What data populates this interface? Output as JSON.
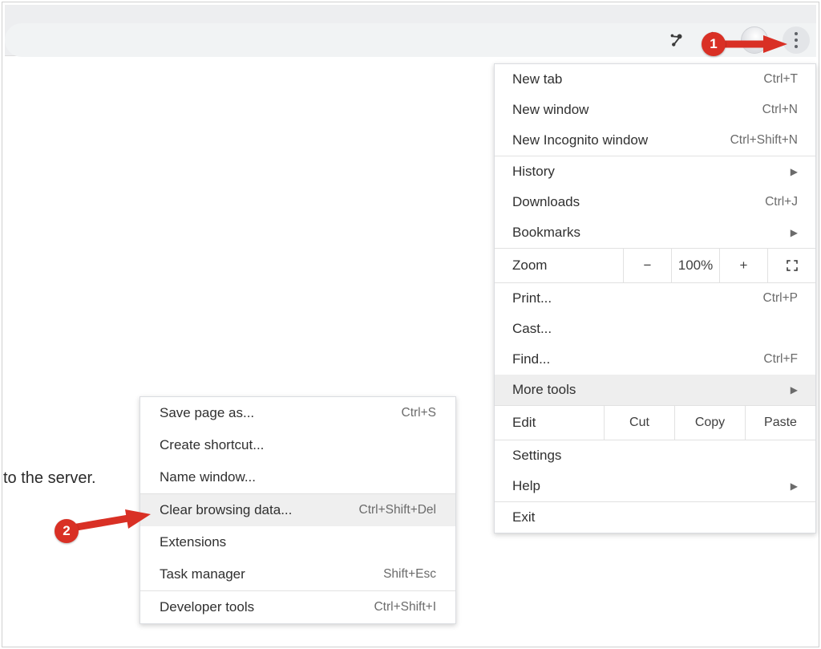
{
  "page": {
    "fragment_text": "to the server."
  },
  "toolbar": {
    "icons": {
      "hubspot": "hubspot-icon",
      "extensions": "extensions-icon",
      "profile": "profile-icon",
      "more": "more-vert-icon"
    }
  },
  "menu": {
    "sections": [
      {
        "items": [
          {
            "label": "New tab",
            "shortcut": "Ctrl+T"
          },
          {
            "label": "New window",
            "shortcut": "Ctrl+N"
          },
          {
            "label": "New Incognito window",
            "shortcut": "Ctrl+Shift+N"
          }
        ]
      },
      {
        "items": [
          {
            "label": "History",
            "submenu": true
          },
          {
            "label": "Downloads",
            "shortcut": "Ctrl+J"
          },
          {
            "label": "Bookmarks",
            "submenu": true
          }
        ]
      },
      {
        "zoom": {
          "label": "Zoom",
          "dec": "−",
          "value": "100%",
          "inc": "+",
          "fullscreen": "fullscreen"
        }
      },
      {
        "items": [
          {
            "label": "Print...",
            "shortcut": "Ctrl+P"
          },
          {
            "label": "Cast..."
          },
          {
            "label": "Find...",
            "shortcut": "Ctrl+F"
          },
          {
            "label": "More tools",
            "submenu": true,
            "highlight": true
          }
        ]
      },
      {
        "edit": {
          "label": "Edit",
          "cut": "Cut",
          "copy": "Copy",
          "paste": "Paste"
        }
      },
      {
        "items": [
          {
            "label": "Settings"
          },
          {
            "label": "Help",
            "submenu": true
          }
        ]
      },
      {
        "items": [
          {
            "label": "Exit"
          }
        ]
      }
    ]
  },
  "submenu": {
    "sections": [
      {
        "items": [
          {
            "label": "Save page as...",
            "shortcut": "Ctrl+S"
          },
          {
            "label": "Create shortcut..."
          },
          {
            "label": "Name window..."
          }
        ]
      },
      {
        "items": [
          {
            "label": "Clear browsing data...",
            "shortcut": "Ctrl+Shift+Del",
            "highlight": true
          },
          {
            "label": "Extensions"
          },
          {
            "label": "Task manager",
            "shortcut": "Shift+Esc"
          }
        ]
      },
      {
        "items": [
          {
            "label": "Developer tools",
            "shortcut": "Ctrl+Shift+I"
          }
        ]
      }
    ]
  },
  "annotations": {
    "step1": "1",
    "step2": "2"
  }
}
